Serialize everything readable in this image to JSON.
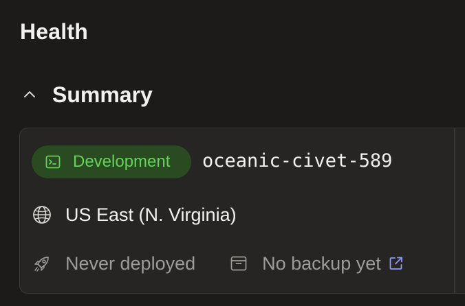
{
  "page": {
    "title": "Health"
  },
  "summary": {
    "title": "Summary",
    "collapse_icon": "chevron-up-icon"
  },
  "deployment": {
    "badge": {
      "label": "Development",
      "icon": "terminal-icon",
      "bg_color": "#2a4a22",
      "text_color": "#65d35b"
    },
    "name": "oceanic-civet-589",
    "region": {
      "label": "US East (N. Virginia)",
      "icon": "globe-icon"
    },
    "deploy_status": {
      "label": "Never deployed",
      "icon": "rocket-icon"
    },
    "backup_status": {
      "label": "No backup yet",
      "icon": "archive-box-icon",
      "link_icon": "external-link-icon",
      "link_color": "#8f9cf5"
    }
  }
}
